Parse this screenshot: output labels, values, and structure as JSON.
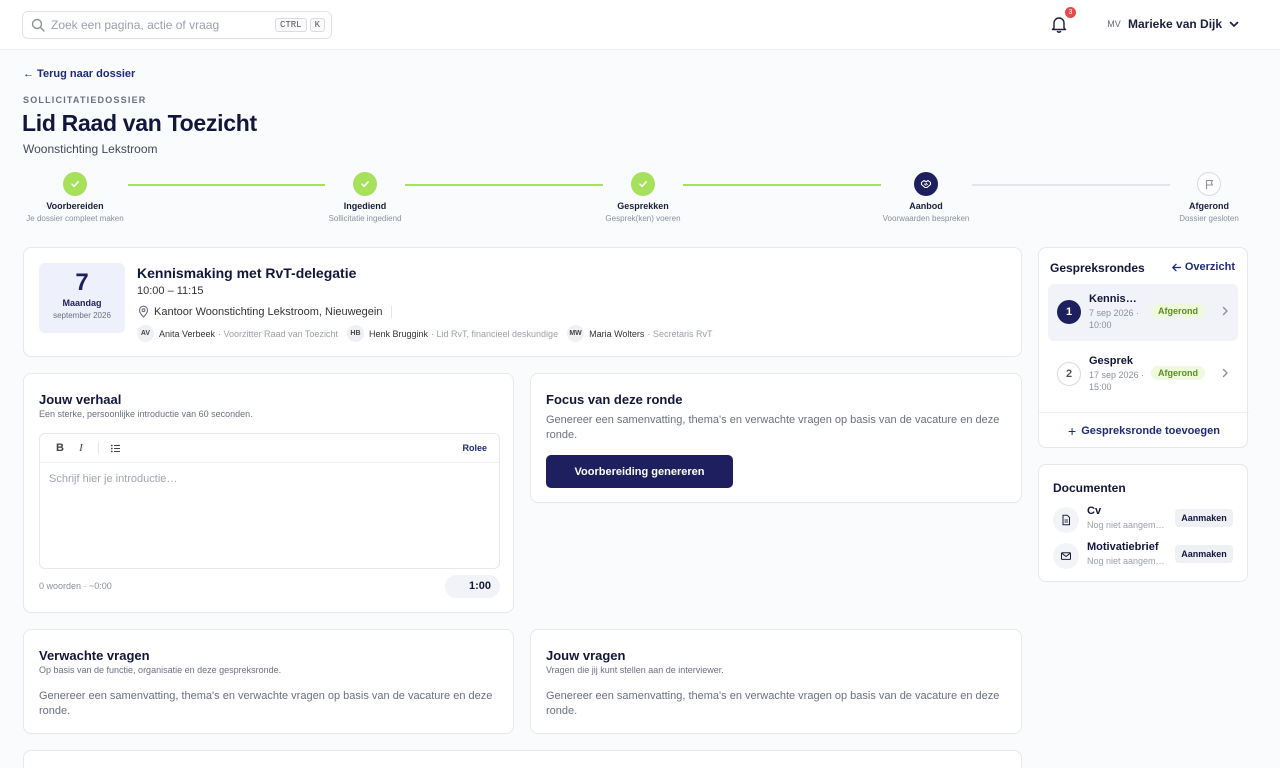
{
  "search": {
    "placeholder": "Zoek een pagina, actie of vraag",
    "kbd1": "CTRL",
    "kbd2": "K"
  },
  "notifications": {
    "count": "3"
  },
  "user": {
    "initials": "MV",
    "name": "Marieke van Dijk"
  },
  "header": {
    "back": "← Terug naar dossier",
    "eyebrow": "SOLLICITATIEDOSSIER",
    "title": "Lid Raad van Toezicht",
    "org": "Woonstichting Lekstroom"
  },
  "steps": [
    {
      "label": "Voorbereiden",
      "sub": "Je dossier compleet maken",
      "state": "done"
    },
    {
      "label": "Ingediend",
      "sub": "Sollicitatie ingediend",
      "state": "done"
    },
    {
      "label": "Gesprekken",
      "sub": "Gesprek(ken) voeren",
      "state": "done"
    },
    {
      "label": "Aanbod",
      "sub": "Voorwaarden bespreken",
      "state": "current"
    },
    {
      "label": "Afgerond",
      "sub": "Dossier gesloten",
      "state": "todo"
    }
  ],
  "meeting": {
    "day_num": "7",
    "weekday": "Maandag",
    "month": "september 2026",
    "title": "Kennismaking met RvT-delegatie",
    "time": "10:00 – 11:15",
    "location": "Kantoor Woonstichting Lekstroom, Nieuwegein",
    "people": [
      {
        "initials": "AV",
        "name": "Anita Verbeek",
        "role": "· Voorzitter Raad van Toezicht"
      },
      {
        "initials": "HB",
        "name": "Henk Bruggink",
        "role": "· Lid RvT, financieel deskundige"
      },
      {
        "initials": "MW",
        "name": "Maria Wolters",
        "role": "· Secretaris RvT"
      }
    ]
  },
  "story": {
    "title": "Jouw verhaal",
    "sub": "Een sterke, persoonlijke introductie van 60 seconden.",
    "toolbar": {
      "bold": "B",
      "italic": "I",
      "role": "Rolee"
    },
    "placeholder": "Schrijf hier je introductie…",
    "wordcount": "0 woorden · ~0:00",
    "timer": "1:00"
  },
  "focus": {
    "title": "Focus van deze ronde",
    "body": "Genereer een samenvatting, thema's en verwachte vragen op basis van de vacature en deze ronde.",
    "button": "Voorbereiding genereren"
  },
  "expected": {
    "title": "Verwachte vragen",
    "sub": "Op basis van de functie, organisatie en deze gespreksronde.",
    "body": "Genereer een samenvatting, thema's en verwachte vragen op basis van de vacature en deze ronde."
  },
  "yourq": {
    "title": "Jouw vragen",
    "sub": "Vragen die jij kunt stellen aan de interviewer.",
    "body": "Genereer een samenvatting, thema's en verwachte vragen op basis van de vacature en deze ronde."
  },
  "rounds": {
    "title": "Gespreksrondes",
    "overview": "Overzicht",
    "items": [
      {
        "num": "1",
        "name": "Kennismaking met RvT-delegatie",
        "date": "7 sep 2026 · 10:00",
        "status": "Afgerond"
      },
      {
        "num": "2",
        "name": "Gesprek",
        "date": "17 sep 2026 · 15:00",
        "status": "Afgerond"
      }
    ],
    "add": "Gespreksronde toevoegen"
  },
  "documents": {
    "title": "Documenten",
    "items": [
      {
        "name": "Cv",
        "status": "Nog niet aangemaakt",
        "button": "Aanmaken",
        "icon": "file-icon"
      },
      {
        "name": "Motivatiebrief",
        "status": "Nog niet aangemaakt",
        "button": "Aanmaken",
        "icon": "mail-icon"
      }
    ]
  },
  "colors": {
    "accent": "#1d1f5e",
    "done": "#a7e05a",
    "badge_bg": "#eef9de",
    "badge_fg": "#5b8f1f"
  }
}
